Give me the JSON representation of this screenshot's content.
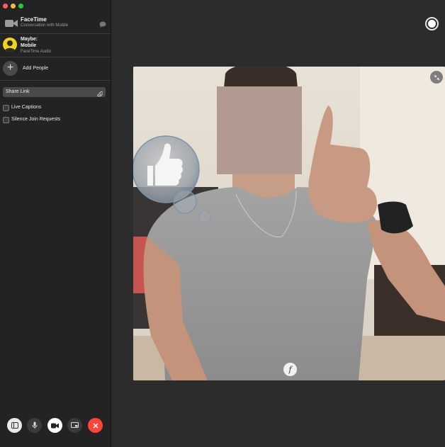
{
  "window": {
    "title": "FaceTime",
    "subtitle": "Conversation with Mobile"
  },
  "participant": {
    "name_line1": "Maybe:",
    "name_line2": "Mobile",
    "status": "FaceTime Audio"
  },
  "actions": {
    "add_people": "Add People",
    "share_link": "Share Link"
  },
  "options": {
    "live_captions": "Live Captions",
    "silence_join_requests": "Silence Join Requests"
  },
  "controls": {
    "icons": [
      "sidebar-icon",
      "microphone-icon",
      "video-camera-icon",
      "screen-share-icon",
      "end-call-icon"
    ]
  },
  "overlay": {
    "effects_glyph": "f",
    "reaction": "thumbs-up"
  },
  "colors": {
    "end_call": "#ff453a",
    "avatar": "#f2d21a",
    "traffic_close": "#ff5f57",
    "traffic_min": "#febc2e",
    "traffic_max": "#28c840"
  }
}
